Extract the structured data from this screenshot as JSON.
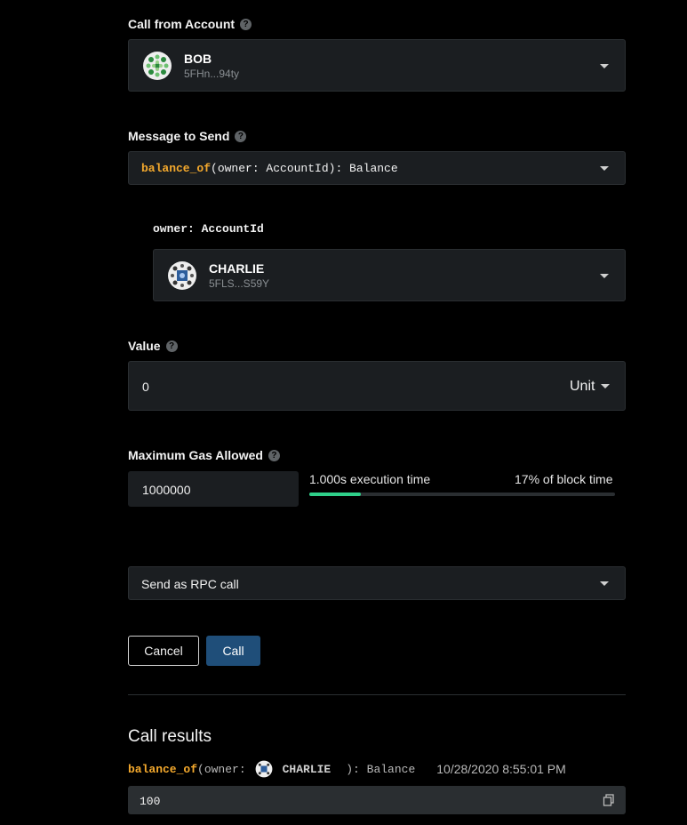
{
  "call_from": {
    "label": "Call from Account",
    "account_name": "BOB",
    "account_address": "5FHn...94ty"
  },
  "message": {
    "label": "Message to Send",
    "fn_name": "balance_of",
    "fn_signature": "(owner: AccountId): Balance"
  },
  "param": {
    "label": "owner: AccountId",
    "account_name": "CHARLIE",
    "account_address": "5FLS...S59Y"
  },
  "value": {
    "label": "Value",
    "amount": "0",
    "unit": "Unit"
  },
  "gas": {
    "label": "Maximum Gas Allowed",
    "amount": "1000000",
    "execution_time": "1.000s execution time",
    "block_time": "17% of block time",
    "progress_fraction": 0.17
  },
  "send_mode": {
    "selected": "Send as RPC call"
  },
  "buttons": {
    "cancel": "Cancel",
    "call": "Call"
  },
  "results": {
    "heading": "Call results",
    "fn_name": "balance_of",
    "sig_open": "(owner:",
    "account_name": "CHARLIE",
    "sig_close": "): Balance",
    "timestamp": "10/28/2020 8:55:01 PM",
    "output": "100"
  },
  "colors": {
    "background": "#000000",
    "field": "#1b1e21",
    "accent_button": "#1f4e79",
    "function_name": "#f4a92d",
    "progress": "#2fd08a"
  }
}
